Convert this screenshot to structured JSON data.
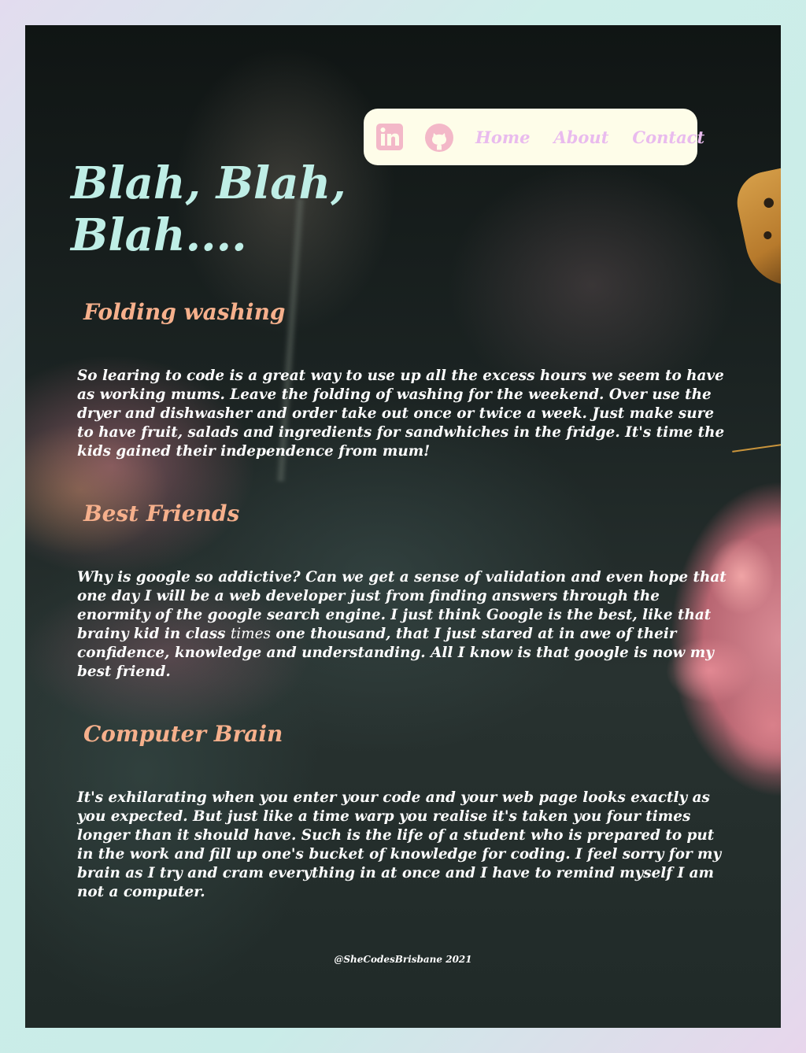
{
  "nav": {
    "icons": [
      "linkedin-icon",
      "github-icon"
    ],
    "links": [
      "Home",
      "About",
      "Contact"
    ]
  },
  "header": {
    "title": "Blah, Blah, Blah...."
  },
  "sections": [
    {
      "heading": "Folding washing",
      "body": "So learing to code is a great way to use up all the excess hours we seem to have as working mums. Leave the folding of washing for the weekend. Over use the dryer and dishwasher and order take out once or twice a week. Just make sure to have fruit, salads and ingredients for sandwhiches in the fridge. It's time the kids gained their independence from mum!"
    },
    {
      "heading": "Best Friends",
      "body_before": "Why is google so addictive? Can we get a sense of validation and even hope that one day I will be a web developer just from finding answers through the enormity of the google search engine. I just think Google is the best, like that brainy kid in class ",
      "body_emphasis": "times",
      "body_after": " one thousand, that I just stared at in awe of their confidence, knowledge and understanding. All I know is that google is now my best friend."
    },
    {
      "heading": "Computer Brain",
      "body": "It's exhilarating when you enter your code and your web page looks exactly as you expected. But just like a time warp you realise it's taken you four times longer than it should have. Such is the life of a student who is prepared to put in the work and fill up one's bucket of knowledge for coding. I feel sorry for my brain as I try and cram everything in at once and I have to remind myself I am not a computer."
    }
  ],
  "footer": {
    "credit": "@SheCodesBrisbane 2021"
  },
  "colors": {
    "title": "#bfeee6",
    "heading": "#f6b08c",
    "nav_bg": "#fefde9",
    "nav_link": "#e9bbee",
    "icon": "#f3b8c8"
  }
}
